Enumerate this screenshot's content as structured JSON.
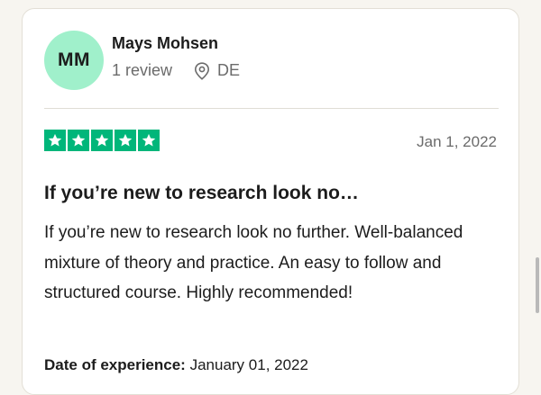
{
  "reviewer": {
    "initials": "MM",
    "name": "Mays Mohsen",
    "review_count": "1 review",
    "location": "DE",
    "avatar_color": "#a0f0cb"
  },
  "review": {
    "rating": 5,
    "star_color": "#00b67a",
    "date": "Jan 1, 2022",
    "title": "If you’re new to research look no…",
    "body": "If you’re new to research look no further. Well-balanced mixture of theory and practice. An easy to follow and structured course. Highly recommended!",
    "experience_label": "Date of experience:",
    "experience_date": "January 01, 2022"
  },
  "icons": {
    "location": "location-pin-icon",
    "star": "star-icon"
  }
}
